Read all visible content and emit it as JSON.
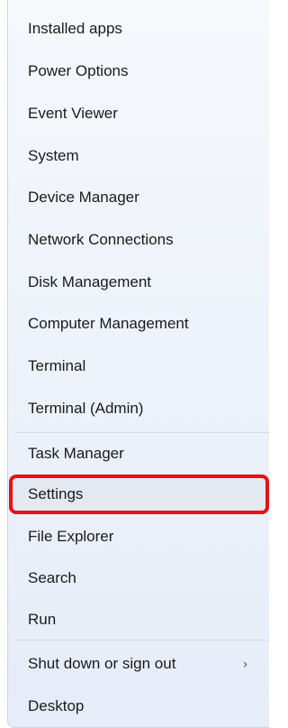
{
  "menu": {
    "items": [
      {
        "label": "Installed apps"
      },
      {
        "label": "Power Options"
      },
      {
        "label": "Event Viewer"
      },
      {
        "label": "System"
      },
      {
        "label": "Device Manager"
      },
      {
        "label": "Network Connections"
      },
      {
        "label": "Disk Management"
      },
      {
        "label": "Computer Management"
      },
      {
        "label": "Terminal"
      },
      {
        "label": "Terminal (Admin)"
      },
      {
        "label": "Task Manager"
      },
      {
        "label": "Settings"
      },
      {
        "label": "File Explorer"
      },
      {
        "label": "Search"
      },
      {
        "label": "Run"
      },
      {
        "label": "Shut down or sign out",
        "submenu_icon": "chevron-right-icon",
        "chevron": "›"
      },
      {
        "label": "Desktop"
      }
    ],
    "highlighted_item": "Settings",
    "highlight_color": "#e21414"
  }
}
